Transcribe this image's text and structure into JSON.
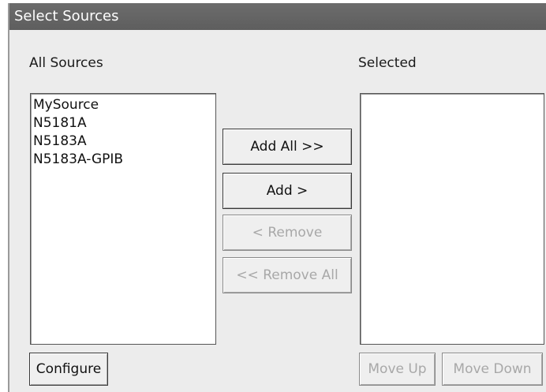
{
  "window": {
    "title": "Select Sources"
  },
  "all_sources": {
    "label": "All Sources",
    "items": [
      "MySource",
      "N5181A",
      "N5183A",
      "N5183A-GPIB"
    ]
  },
  "selected": {
    "label": "Selected",
    "items": []
  },
  "buttons": {
    "add_all": "Add All >>",
    "add": "Add >",
    "remove": "< Remove",
    "remove_all": "<< Remove All",
    "configure": "Configure",
    "move_up": "Move Up",
    "move_down": "Move Down"
  }
}
